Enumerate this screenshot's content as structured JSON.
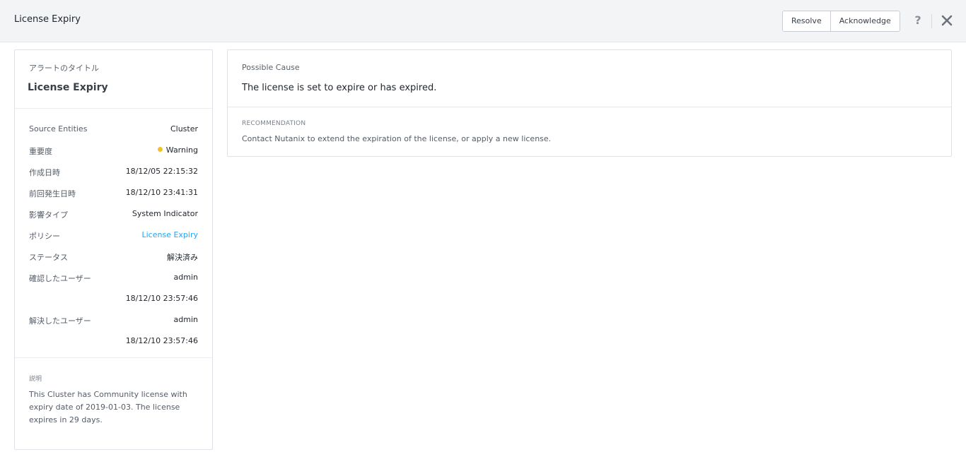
{
  "header": {
    "title": "License Expiry",
    "resolve_label": "Resolve",
    "acknowledge_label": "Acknowledge",
    "help_label": "?"
  },
  "summary": {
    "title_label": "アラートのタイトル",
    "title": "License Expiry",
    "rows": [
      {
        "key": "Source Entities",
        "value": "Cluster"
      },
      {
        "key": "重要度",
        "value": "Warning"
      },
      {
        "key": "作成日時",
        "value": "18/12/05 22:15:32"
      },
      {
        "key": "前回発生日時",
        "value": "18/12/10 23:41:31"
      },
      {
        "key": "影響タイプ",
        "value": "System Indicator"
      },
      {
        "key": "ポリシー",
        "value": "License Expiry"
      },
      {
        "key": "ステータス",
        "value": "解決済み"
      },
      {
        "key": "確認したユーザー",
        "value": "admin"
      },
      {
        "key": "",
        "value": "18/12/10 23:57:46"
      },
      {
        "key": "解決したユーザー",
        "value": "admin"
      },
      {
        "key": "",
        "value": "18/12/10 23:57:46"
      }
    ],
    "severity_color": "#f5c026",
    "link_color": "#22a5f7",
    "description_label": "説明",
    "description": "This Cluster has Community license with expiry date of 2019-01-03. The license expires in 29 days."
  },
  "details": {
    "cause_label": "Possible Cause",
    "cause": "The license is set to expire or has expired.",
    "recommendation_label": "RECOMMENDATION",
    "recommendation": "Contact Nutanix to extend the expiration of the license, or apply a new license."
  }
}
